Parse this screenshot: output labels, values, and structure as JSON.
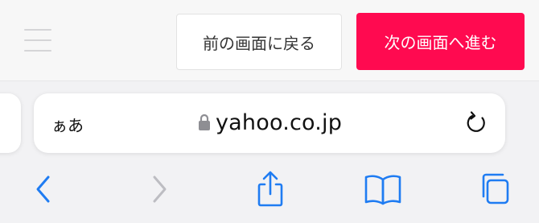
{
  "page": {
    "menu_icon": "hamburger-menu-icon",
    "prev_button_label": "前の画面に戻る",
    "next_button_label": "次の画面へ進む",
    "next_button_color": "#ff0a50"
  },
  "address_bar": {
    "reader_label": "ぁあ",
    "url": "yahoo.co.jp",
    "secure_icon": "lock-icon",
    "reload_icon": "reload-icon"
  },
  "toolbar": {
    "accent_color": "#1f7cf2",
    "disabled_color": "#bdbdc2",
    "items": [
      {
        "name": "back",
        "icon": "chevron-left-icon",
        "enabled": true
      },
      {
        "name": "forward",
        "icon": "chevron-right-icon",
        "enabled": false
      },
      {
        "name": "share",
        "icon": "share-icon",
        "enabled": true
      },
      {
        "name": "bookmarks",
        "icon": "book-icon",
        "enabled": true
      },
      {
        "name": "tabs",
        "icon": "tabs-icon",
        "enabled": true
      }
    ]
  }
}
